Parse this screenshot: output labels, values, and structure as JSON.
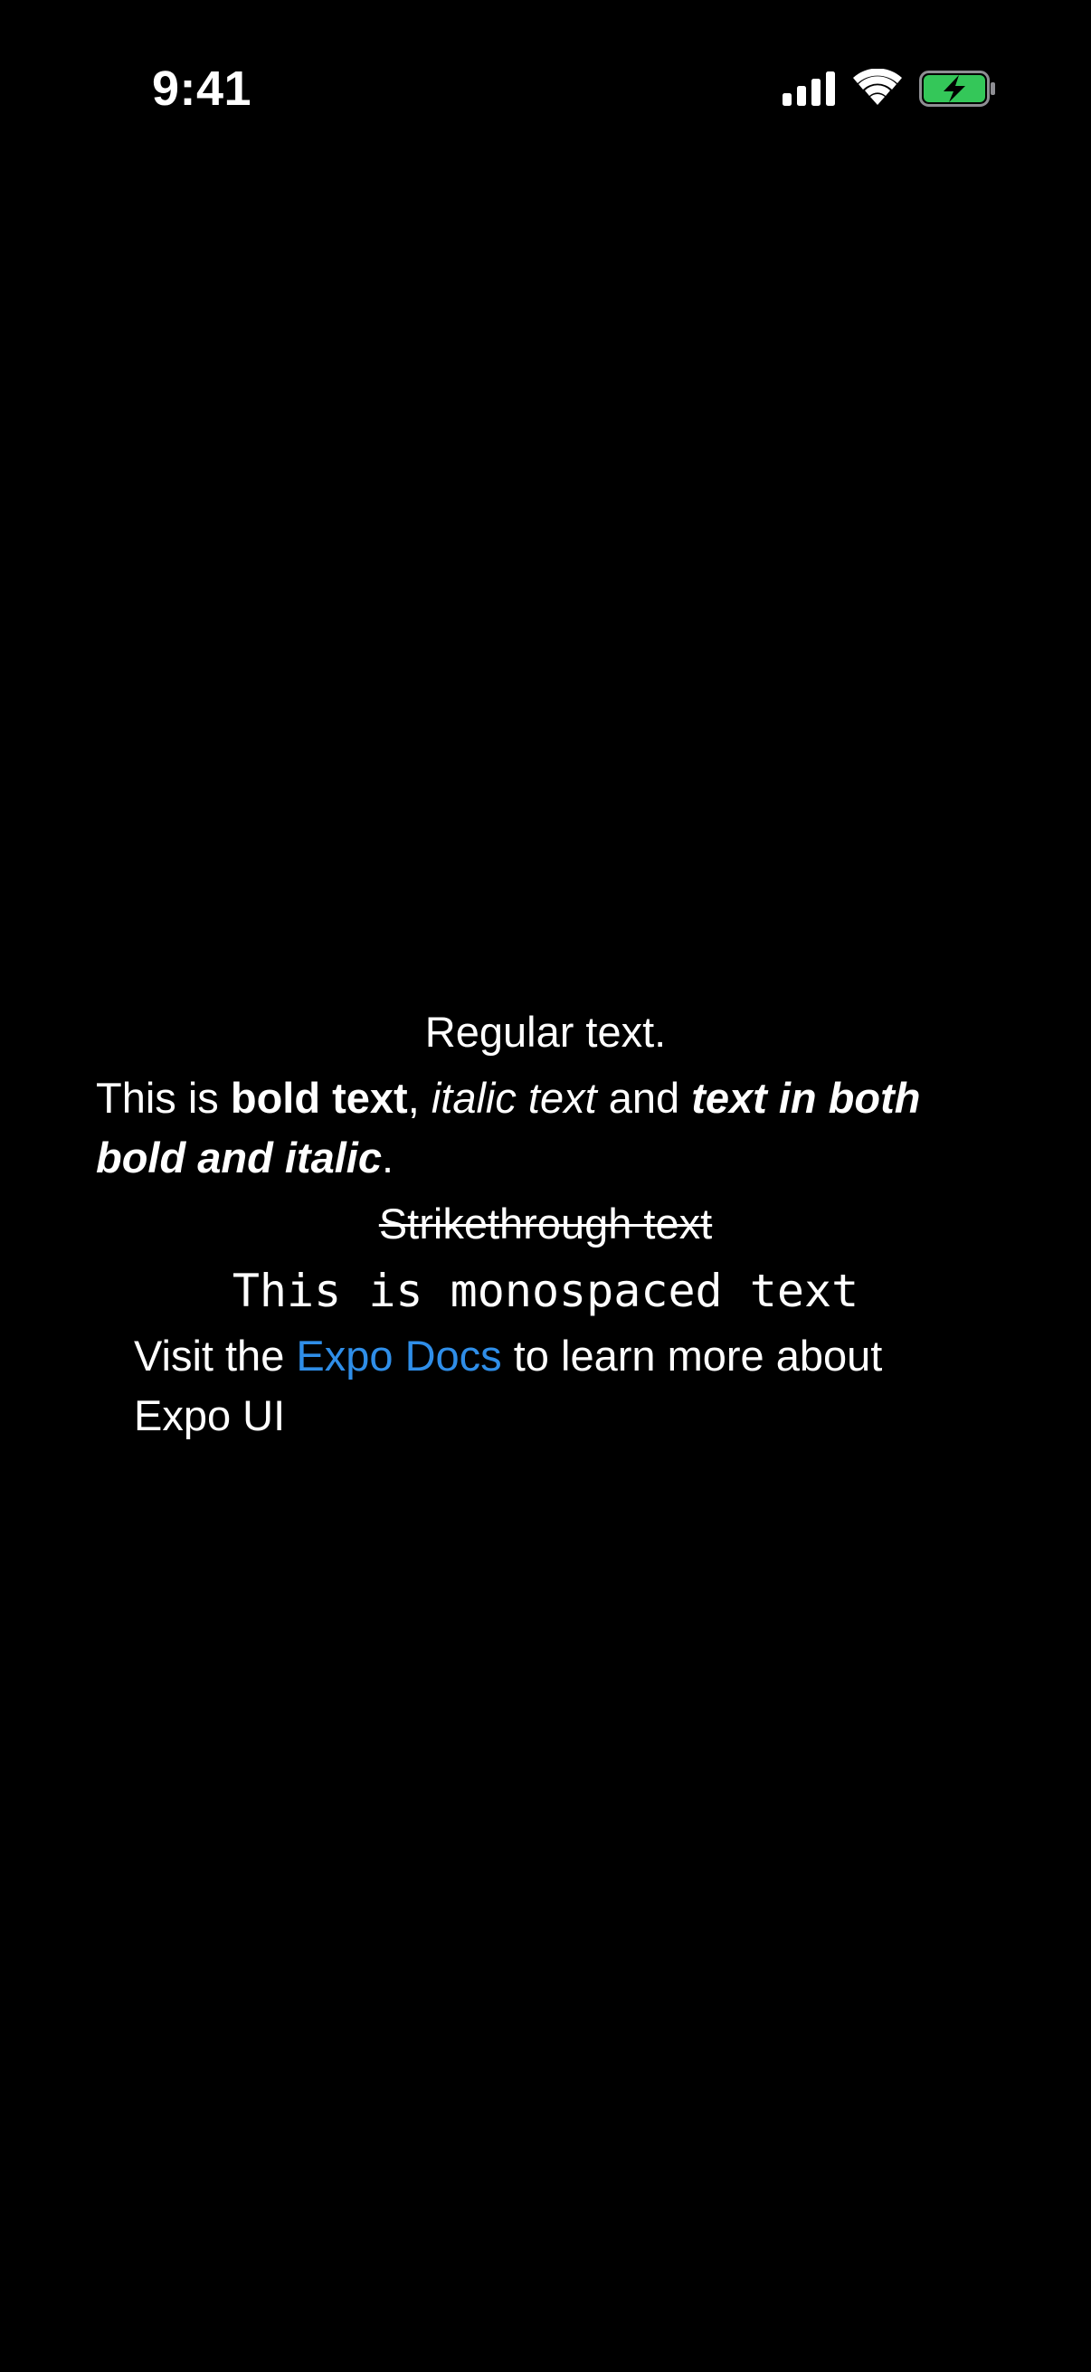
{
  "status_bar": {
    "time": "9:41",
    "icons": [
      "signal-icon",
      "wifi-icon",
      "battery-charging-icon"
    ],
    "battery_color": "#34c759"
  },
  "content": {
    "regular": "Regular text.",
    "styled": {
      "prefix": "This is ",
      "bold": "bold text",
      "sep1": ", ",
      "italic": "italic text",
      "sep2": " and ",
      "bold_italic": "text in both bold and italic",
      "suffix": "."
    },
    "strikethrough": "Strikethrough text",
    "monospace": "This is monospaced text",
    "link_line": {
      "prefix": "Visit the ",
      "link_text": "Expo Docs",
      "suffix": " to learn more about Expo UI",
      "link_color": "#2f8ee8"
    }
  }
}
